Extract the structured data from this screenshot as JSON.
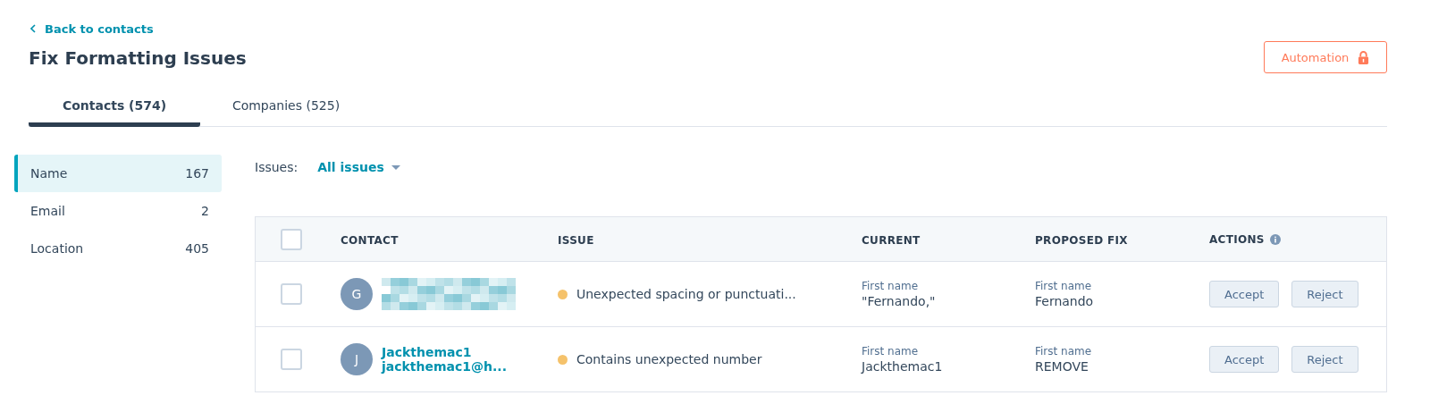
{
  "back_link": "Back to contacts",
  "title": "Fix Formatting Issues",
  "automation_button": {
    "label": "Automation",
    "locked": true
  },
  "tabs": [
    {
      "label": "Contacts (574)",
      "selected": true
    },
    {
      "label": "Companies (525)",
      "selected": false
    }
  ],
  "sidebar": {
    "items": [
      {
        "label": "Name",
        "count": "167",
        "selected": true
      },
      {
        "label": "Email",
        "count": "2",
        "selected": false
      },
      {
        "label": "Location",
        "count": "405",
        "selected": false
      }
    ]
  },
  "filter": {
    "label": "Issues:",
    "value": "All issues"
  },
  "table": {
    "select_all_checked": false,
    "columns": [
      "CONTACT",
      "ISSUE",
      "CURRENT",
      "PROPOSED FIX",
      "ACTIONS"
    ],
    "rows": [
      {
        "checked": false,
        "initial": "G",
        "redacted": true,
        "issue": "Unexpected spacing or punctuati...",
        "color": "#f5c26b",
        "current_label": "First name",
        "current": "\"Fernando,\"",
        "fix_label": "First name",
        "fix": "Fernando",
        "actions": [
          "Accept",
          "Reject"
        ]
      },
      {
        "checked": false,
        "initial": "J",
        "redacted": false,
        "name": "Jackthemac1",
        "email": "jackthemac1@h...",
        "issue": "Contains unexpected number",
        "color": "#f5c26b",
        "current_label": "First name",
        "current": "Jackthemac1",
        "fix_label": "First name",
        "fix": "REMOVE",
        "actions": [
          "Accept",
          "Reject"
        ]
      }
    ]
  }
}
